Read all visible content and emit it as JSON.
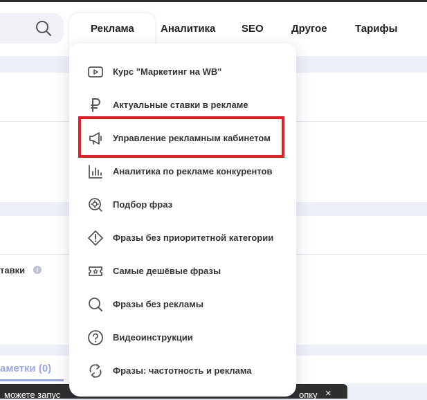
{
  "nav": {
    "items": [
      "Реклама",
      "Аналитика",
      "SEO",
      "Другое",
      "Тарифы"
    ],
    "active_index": 0
  },
  "background": {
    "bid_label": "тавки",
    "info_glyph": "i",
    "notes_tab": "аметки (0)"
  },
  "toast": {
    "text_left": "можете запус",
    "text_right": "опку",
    "close": "×"
  },
  "menu": {
    "items": [
      {
        "label": "Курс \"Маркетинг на WB\"",
        "icon": "play-icon"
      },
      {
        "label": "Актуальные ставки в рекламе",
        "icon": "ruble-icon"
      },
      {
        "label": "Управление рекламным кабинетом",
        "icon": "megaphone-icon"
      },
      {
        "label": "Аналитика по рекламе конкурентов",
        "icon": "bar-chart-icon"
      },
      {
        "label": "Подбор фраз",
        "icon": "search-plus-icon"
      },
      {
        "label": "Фразы без приоритетной категории",
        "icon": "diamond-alert-icon"
      },
      {
        "label": "Самые дешёвые фразы",
        "icon": "ticket-icon"
      },
      {
        "label": "Фразы без рекламы",
        "icon": "search-icon"
      },
      {
        "label": "Видеоинструкции",
        "icon": "question-icon"
      },
      {
        "label": "Фразы: частотность и реклама",
        "icon": "cycle-arrows-icon"
      }
    ],
    "highlighted_index": 2
  },
  "colors": {
    "highlight": "#e31e24",
    "accent": "#9aa7ec",
    "text": "#333333"
  }
}
